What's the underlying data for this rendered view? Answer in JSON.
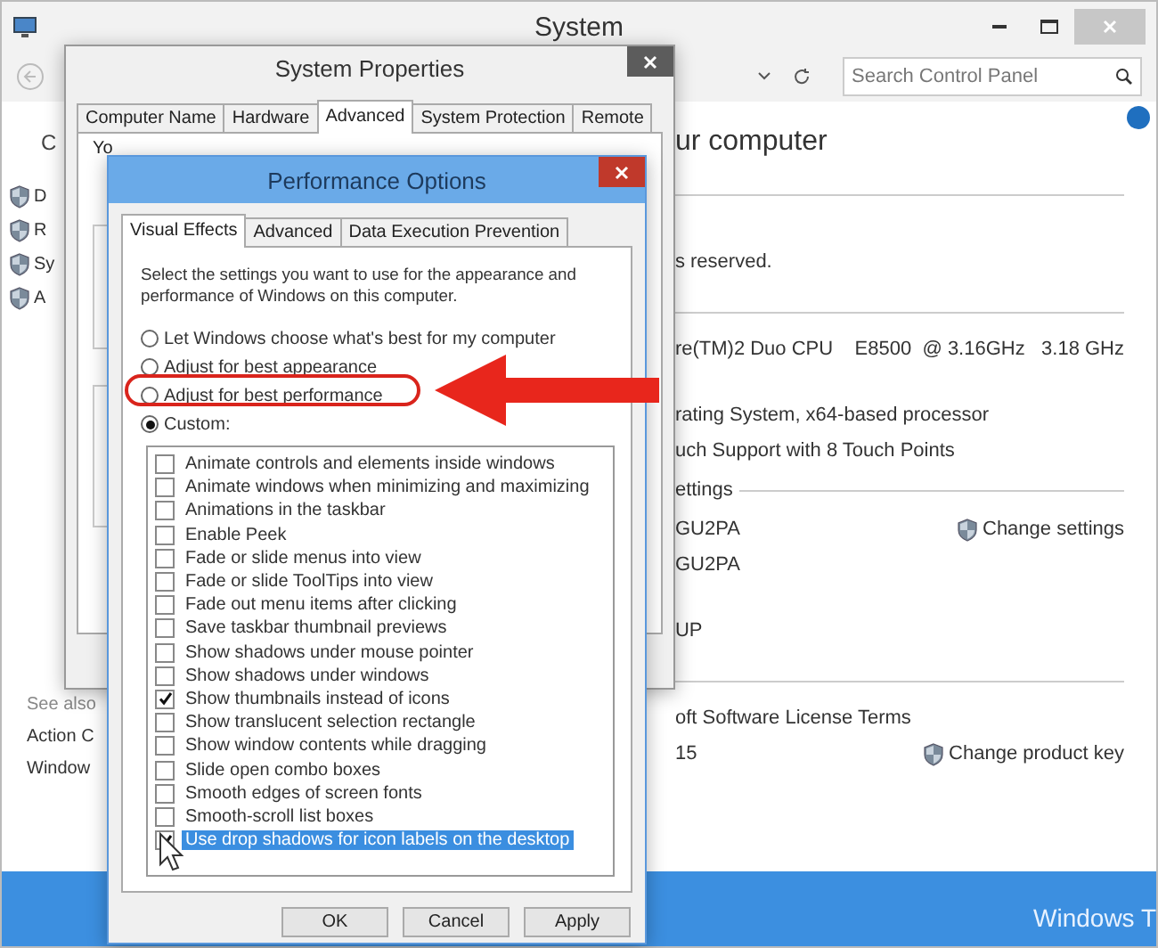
{
  "system_window": {
    "title": "System",
    "search": {
      "placeholder": "Search Control Panel"
    },
    "sidebar": {
      "heading": "C",
      "items": [
        {
          "label": "D"
        },
        {
          "label": "R"
        },
        {
          "label": "Sy"
        },
        {
          "label": "A"
        }
      ]
    },
    "see_also": {
      "heading": "See also",
      "links": [
        "Action C",
        "Window"
      ]
    },
    "content": [
      {
        "kind": "heading",
        "text": "ur computer"
      },
      {
        "kind": "divider"
      },
      {
        "kind": "gap"
      },
      {
        "kind": "text",
        "text": "s reserved."
      },
      {
        "kind": "divider"
      },
      {
        "kind": "text",
        "text": "re(TM)2 Duo CPU    E8500  @ 3.16GHz   3.18 GHz"
      },
      {
        "kind": "gap"
      },
      {
        "kind": "text",
        "text": "rating System, x64-based processor"
      },
      {
        "kind": "text",
        "text": "uch Support with 8 Touch Points"
      },
      {
        "kind": "section",
        "text": "ettings"
      },
      {
        "kind": "text",
        "text": "GU2PA",
        "link": "Change settings"
      },
      {
        "kind": "text",
        "text": "GU2PA"
      },
      {
        "kind": "gap"
      },
      {
        "kind": "text",
        "text": "UP"
      },
      {
        "kind": "divider"
      },
      {
        "kind": "text",
        "text": "oft Software License Terms"
      },
      {
        "kind": "text",
        "text": "15",
        "link": "Change product key"
      }
    ],
    "taskbar_text": "Windows T"
  },
  "system_properties": {
    "title": "System Properties",
    "tabs": [
      {
        "label": "Computer Name",
        "selected": false
      },
      {
        "label": "Hardware",
        "selected": false
      },
      {
        "label": "Advanced",
        "selected": true
      },
      {
        "label": "System Protection",
        "selected": false
      },
      {
        "label": "Remote",
        "selected": false
      }
    ],
    "intro": "Yo"
  },
  "performance_options": {
    "title": "Performance Options",
    "tabs": [
      {
        "label": "Visual Effects",
        "selected": true
      },
      {
        "label": "Advanced",
        "selected": false
      },
      {
        "label": "Data Execution Prevention",
        "selected": false
      }
    ],
    "description": "Select the settings you want to use for the appearance and performance of Windows on this computer.",
    "radios": [
      {
        "label": "Let Windows choose what's best for my computer",
        "selected": false
      },
      {
        "label": "Adjust for best appearance",
        "selected": false
      },
      {
        "label": "Adjust for best performance",
        "selected": false,
        "highlighted": true
      },
      {
        "label": "Custom:",
        "selected": true
      }
    ],
    "effects": [
      {
        "label": "Animate controls and elements inside windows",
        "checked": false,
        "selected": false
      },
      {
        "label": "Animate windows when minimizing and maximizing",
        "checked": false,
        "selected": false
      },
      {
        "label": "Animations in the taskbar",
        "checked": false,
        "selected": false
      },
      {
        "label": "Enable Peek",
        "checked": false,
        "selected": false
      },
      {
        "label": "Fade or slide menus into view",
        "checked": false,
        "selected": false
      },
      {
        "label": "Fade or slide ToolTips into view",
        "checked": false,
        "selected": false
      },
      {
        "label": "Fade out menu items after clicking",
        "checked": false,
        "selected": false
      },
      {
        "label": "Save taskbar thumbnail previews",
        "checked": false,
        "selected": false
      },
      {
        "label": "Show shadows under mouse pointer",
        "checked": false,
        "selected": false
      },
      {
        "label": "Show shadows under windows",
        "checked": false,
        "selected": false
      },
      {
        "label": "Show thumbnails instead of icons",
        "checked": true,
        "selected": false
      },
      {
        "label": "Show translucent selection rectangle",
        "checked": false,
        "selected": false
      },
      {
        "label": "Show window contents while dragging",
        "checked": false,
        "selected": false
      },
      {
        "label": "Slide open combo boxes",
        "checked": false,
        "selected": false
      },
      {
        "label": "Smooth edges of screen fonts",
        "checked": false,
        "selected": false
      },
      {
        "label": "Smooth-scroll list boxes",
        "checked": false,
        "selected": false
      },
      {
        "label": "Use drop shadows for icon labels on the desktop",
        "checked": true,
        "selected": true
      }
    ],
    "buttons": [
      "OK",
      "Cancel",
      "Apply"
    ]
  }
}
